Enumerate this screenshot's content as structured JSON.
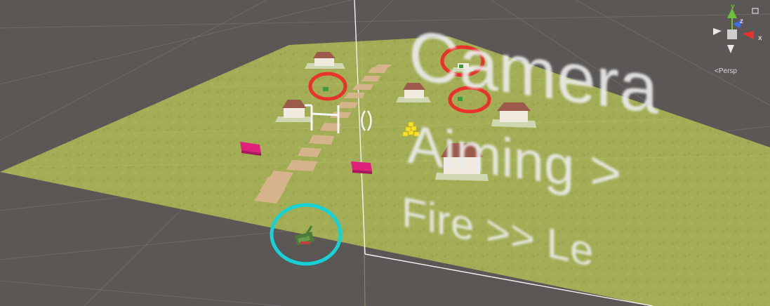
{
  "scene_view": {
    "world_text": {
      "line1": "Camera",
      "line2": "Aiming >",
      "line3": "Fire >> Le"
    },
    "gizmo": {
      "axis_y": "y",
      "axis_z": "z",
      "axis_x": "x",
      "projection_label": "<Persp",
      "axis_colors": {
        "x": "#e8322b",
        "y": "#6cc23a",
        "z": "#3d6fe0"
      }
    },
    "markers": {
      "enemy_color": "#e8322b",
      "player_color": "#16d2d6"
    },
    "colors": {
      "ground": "#a0ac52",
      "grid_background": "#5a5755",
      "grid_lines": "#6e6b69"
    }
  }
}
